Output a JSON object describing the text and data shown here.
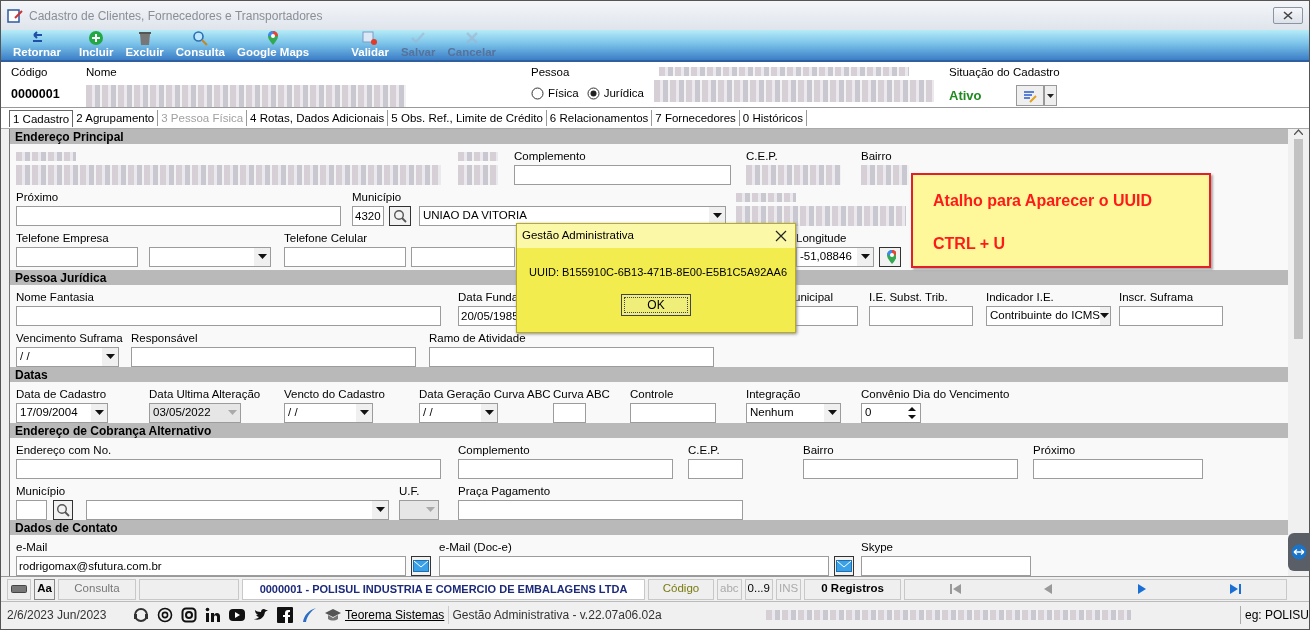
{
  "window": {
    "title": "Cadastro de Clientes, Fornecedores e Transportadores"
  },
  "toolbar": [
    {
      "label": "Retornar",
      "kind": "back",
      "disabled": false
    },
    {
      "label": "Incluir",
      "kind": "add",
      "disabled": false
    },
    {
      "label": "Excluir",
      "kind": "delete",
      "disabled": false
    },
    {
      "label": "Consulta",
      "kind": "search",
      "disabled": false
    },
    {
      "label": "Google Maps",
      "kind": "maps",
      "disabled": false
    },
    {
      "label": "Validar",
      "kind": "validate",
      "disabled": false
    },
    {
      "label": "Salvar",
      "kind": "save",
      "disabled": true
    },
    {
      "label": "Cancelar",
      "kind": "cancel",
      "disabled": true
    }
  ],
  "header": {
    "code_label": "Código",
    "code": "0000001",
    "name_label": "Nome",
    "pessoa_label": "Pessoa",
    "pessoa_options": [
      {
        "label": "Física",
        "selected": false
      },
      {
        "label": "Jurídica",
        "selected": true
      }
    ],
    "situacao_label": "Situação do Cadastro",
    "situacao": "Ativo"
  },
  "tabs": [
    {
      "label": "1 Cadastro",
      "selected": true,
      "disabled": false
    },
    {
      "label": "2 Agrupamento",
      "selected": false,
      "disabled": false
    },
    {
      "label": "3 Pessoa Física",
      "selected": false,
      "disabled": true
    },
    {
      "label": "4 Rotas, Dados Adicionais",
      "selected": false,
      "disabled": false
    },
    {
      "label": "5 Obs. Ref., Limite de Crédito",
      "selected": false,
      "disabled": false
    },
    {
      "label": "6 Relacionamentos",
      "selected": false,
      "disabled": false
    },
    {
      "label": "7 Fornecedores",
      "selected": false,
      "disabled": false
    },
    {
      "label": "0 Históricos",
      "selected": false,
      "disabled": false
    }
  ],
  "sections": [
    {
      "title": "Endereço Principal",
      "rows": [
        {
          "fields": [
            {
              "kind": "redacted"
            },
            {
              "kind": "redacted"
            },
            {
              "label": "Complemento",
              "kind": "text",
              "disabled": false
            },
            {
              "label": "C.E.P.",
              "kind": "redacted"
            },
            {
              "label": "Bairro",
              "kind": "redacted"
            }
          ]
        },
        {
          "fields": [
            {
              "label": "Próximo",
              "kind": "text",
              "disabled": false
            },
            {
              "label": "Município",
              "kind": "text",
              "value": "4320",
              "disabled": false
            },
            {
              "kind": "search"
            },
            {
              "kind": "combo",
              "value": "UNIAO DA VITORIA",
              "disabled": false
            },
            {
              "kind": "redacted"
            }
          ]
        },
        {
          "fields": [
            {
              "label": "Telefone Empresa",
              "kind": "text",
              "disabled": false
            },
            {
              "kind": "combo",
              "disabled": false
            },
            {
              "label": "Telefone Celular",
              "kind": "text",
              "disabled": false
            },
            {
              "kind": "text",
              "disabled": false
            },
            {
              "label": "Longitude",
              "kind": "combo",
              "value": "-51,08846",
              "disabled": false
            },
            {
              "kind": "map"
            }
          ]
        }
      ]
    },
    {
      "title": "Pessoa Jurídica",
      "rows": [
        {
          "fields": [
            {
              "label": "Nome Fantasia",
              "kind": "text",
              "disabled": false
            },
            {
              "label": "Data Funda",
              "kind": "text",
              "value": "20/05/1985",
              "disabled": false
            },
            {
              "label": "unicipal",
              "kind": "text",
              "disabled": false
            },
            {
              "label": "I.E. Subst. Trib.",
              "kind": "text",
              "disabled": false
            },
            {
              "label": "Indicador I.E.",
              "kind": "combo",
              "value": "Contribuinte do ICMS",
              "disabled": false
            },
            {
              "label": "Inscr. Suframa",
              "kind": "text",
              "disabled": false
            }
          ]
        },
        {
          "fields": [
            {
              "label": "Vencimento Suframa",
              "kind": "combo",
              "value": "/ /",
              "disabled": false
            },
            {
              "label": "Responsável",
              "kind": "text",
              "disabled": false
            },
            {
              "label": "Ramo de Atividade",
              "kind": "text",
              "disabled": false
            }
          ]
        }
      ]
    },
    {
      "title": "Datas",
      "rows": [
        {
          "fields": [
            {
              "label": "Data de Cadastro",
              "kind": "combo",
              "value": "17/09/2004",
              "disabled": false
            },
            {
              "label": "Data Ultima Alteração",
              "kind": "combo",
              "value": "03/05/2022",
              "disabled": true
            },
            {
              "label": "Vencto do Cadastro",
              "kind": "combo",
              "value": "/ /",
              "disabled": false
            },
            {
              "label": "Data Geração Curva ABC",
              "kind": "combo",
              "value": "/ /",
              "disabled": false
            },
            {
              "label": "Curva ABC",
              "kind": "text",
              "disabled": false
            },
            {
              "label": "Controle",
              "kind": "text",
              "disabled": false
            },
            {
              "label": "Integração",
              "kind": "combo",
              "value": "Nenhum",
              "disabled": false
            },
            {
              "label": "Convênio Dia do Vencimento",
              "kind": "spin",
              "value": "0",
              "disabled": false
            }
          ]
        }
      ]
    },
    {
      "title": "Endereço de Cobrança Alternativo",
      "rows": [
        {
          "fields": [
            {
              "label": "Endereço com No.",
              "kind": "text",
              "disabled": false
            },
            {
              "label": "Complemento",
              "kind": "text",
              "disabled": false
            },
            {
              "label": "C.E.P.",
              "kind": "text",
              "disabled": false
            },
            {
              "label": "Bairro",
              "kind": "text",
              "disabled": false
            },
            {
              "label": "Próximo",
              "kind": "text",
              "disabled": false
            }
          ]
        },
        {
          "fields": [
            {
              "label": "Município",
              "kind": "text",
              "disabled": false
            },
            {
              "kind": "search"
            },
            {
              "kind": "combo",
              "disabled": false
            },
            {
              "label": "U.F.",
              "kind": "combo",
              "disabled": true
            },
            {
              "label": "Praça Pagamento",
              "kind": "text",
              "disabled": false
            }
          ]
        }
      ]
    },
    {
      "title": "Dados de Contato",
      "rows": [
        {
          "fields": [
            {
              "label": "e-Mail",
              "kind": "text",
              "value": "rodrigomax@sfutura.com.br",
              "disabled": false
            },
            {
              "kind": "mail"
            },
            {
              "label": "e-Mail (Doc-e)",
              "kind": "text",
              "disabled": false
            },
            {
              "kind": "mail"
            },
            {
              "label": "Skype",
              "kind": "text",
              "disabled": false
            }
          ]
        }
      ]
    }
  ],
  "bottom_bar": {
    "aa": "Aa",
    "consulta": "Consulta",
    "record": "0000001 - POLISUL INDUSTRIA E COMERCIO DE EMBALAGENS LTDA",
    "order": "Código",
    "indicators": [
      {
        "label": "abc",
        "on": false
      },
      {
        "label": "0...9",
        "on": true
      },
      {
        "label": "INS",
        "on": false
      }
    ],
    "count": "0 Registros",
    "navigation": [
      {
        "kind": "first",
        "disabled": true
      },
      {
        "kind": "prev",
        "disabled": true
      },
      {
        "kind": "next",
        "disabled": false
      },
      {
        "kind": "last",
        "disabled": false
      }
    ]
  },
  "status_bar": {
    "date": "2/6/2023 Jun/2023",
    "link": "Teorema Sistemas",
    "version": "Gestão Administrativa - v.22.07a06.02a",
    "user": "eg: POLISU"
  },
  "dialog": {
    "title": "Gestão Administrativa",
    "message": "UUID: B155910C-6B13-471B-8E00-E5B1C5A92AA6",
    "button": "OK"
  },
  "callout": {
    "lines": [
      "Atalho para Aparecer o UUID",
      "CTRL + U"
    ]
  }
}
